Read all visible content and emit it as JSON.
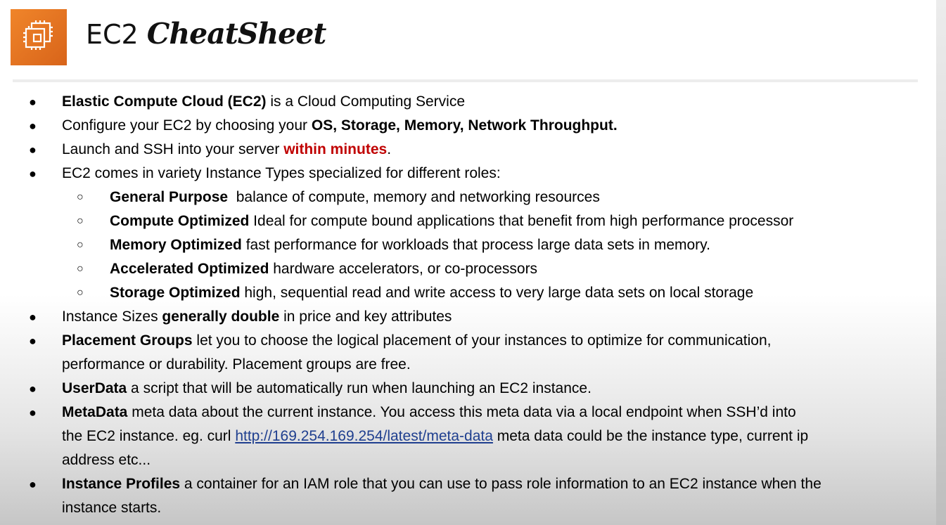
{
  "header": {
    "logo_icon": "ec2-chip-icon",
    "logo_color": "#e8741f",
    "title_plain": "EC2",
    "title_script": "CheatSheet"
  },
  "bullet_symbol": "●",
  "sub_bullet_symbol": "○",
  "items": [
    {
      "b": "Elastic Compute Cloud (EC2)",
      "t": " is a Cloud Computing Service"
    },
    {
      "t": "Configure your EC2 by choosing your ",
      "b": "OS, Storage, Memory, Network Throughput."
    },
    {
      "t": "Launch and SSH into your server ",
      "r": "within minutes",
      "t2": "."
    },
    {
      "t": "EC2 comes in variety Instance Types specialized for different roles:"
    },
    {
      "b": "General Purpose",
      "t": "  balance of compute, memory and networking resources"
    },
    {
      "b": "Compute Optimized",
      "t": " Ideal for compute bound applications that benefit from high performance processor"
    },
    {
      "b": "Memory Optimized",
      "t": " fast performance for workloads that process large data sets in memory."
    },
    {
      "b": "Accelerated Optimized",
      "t": " hardware accelerators, or co-processors"
    },
    {
      "b": "Storage Optimized",
      "t": " high, sequential read and write access to very large data sets on local storage"
    },
    {
      "t": "Instance Sizes ",
      "b": "generally double",
      "t2": " in price and key attributes"
    },
    {
      "b": "Placement Groups",
      "t": " let you to choose the logical placement of your instances to optimize for communication,",
      "line2": "performance or durability. Placement groups are free."
    },
    {
      "b": "UserData",
      "t": " a script that will be automatically run when launching an EC2 instance."
    },
    {
      "b": "MetaData",
      "t": " meta data about the current instance. You access this meta data via a local endpoint when SSH’d into",
      "line2a": "the EC2 instance. eg. curl ",
      "link": "http://169.254.169.254/latest/meta-data",
      "line2b": " meta data could be the instance type, current ip",
      "line3": "address etc..."
    },
    {
      "b": "Instance Profiles",
      "t": " a container for an IAM role that you can use to pass role information to an EC2 instance when the",
      "line2": "instance starts."
    }
  ]
}
